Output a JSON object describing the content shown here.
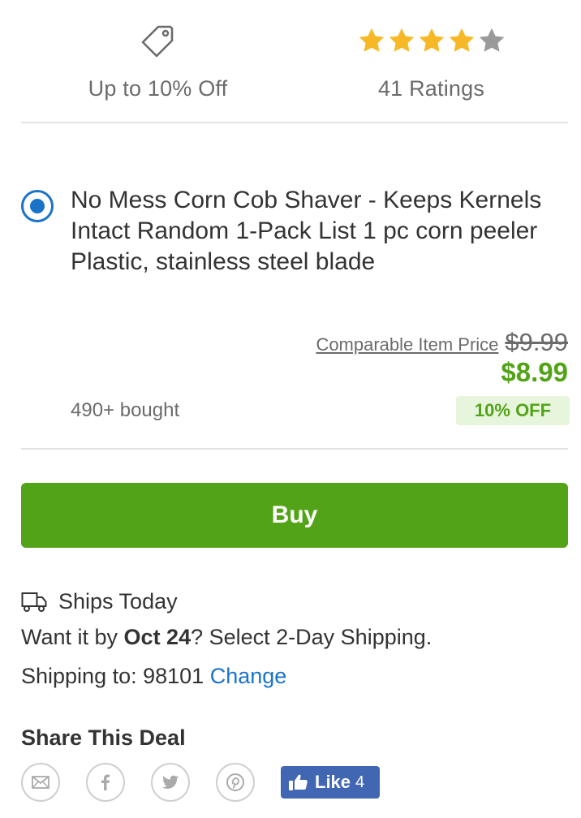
{
  "summary": {
    "discount_label": "Up to 10% Off",
    "rating_label": "41 Ratings",
    "rating_value": 4,
    "rating_max": 5,
    "star_color": "#f6b826",
    "star_empty_color": "#9a9a9a"
  },
  "option": {
    "title": "No Mess Corn Cob Shaver - Keeps Kernels Intact Random 1-Pack List 1 pc corn peeler Plastic, stainless steel blade",
    "selected": true,
    "compare_label": "Comparable Item Price",
    "compare_price": "$9.99",
    "price": "$8.99",
    "bought": "490+ bought",
    "discount_badge": "10% OFF"
  },
  "actions": {
    "buy_label": "Buy"
  },
  "shipping": {
    "ships_label": "Ships Today",
    "want_prefix": "Want it by ",
    "want_date": "Oct 24",
    "want_suffix": "? Select 2-Day Shipping.",
    "shipto_label": "Shipping to: 98101",
    "change_label": "Change"
  },
  "share": {
    "title": "Share This Deal",
    "icons": [
      "email-icon",
      "facebook-icon",
      "twitter-icon",
      "pinterest-icon"
    ],
    "like_label": "Like",
    "like_count": "4"
  },
  "colors": {
    "accent_green": "#53a318",
    "link_blue": "#1a73c9",
    "facebook_blue": "#4267b2"
  }
}
